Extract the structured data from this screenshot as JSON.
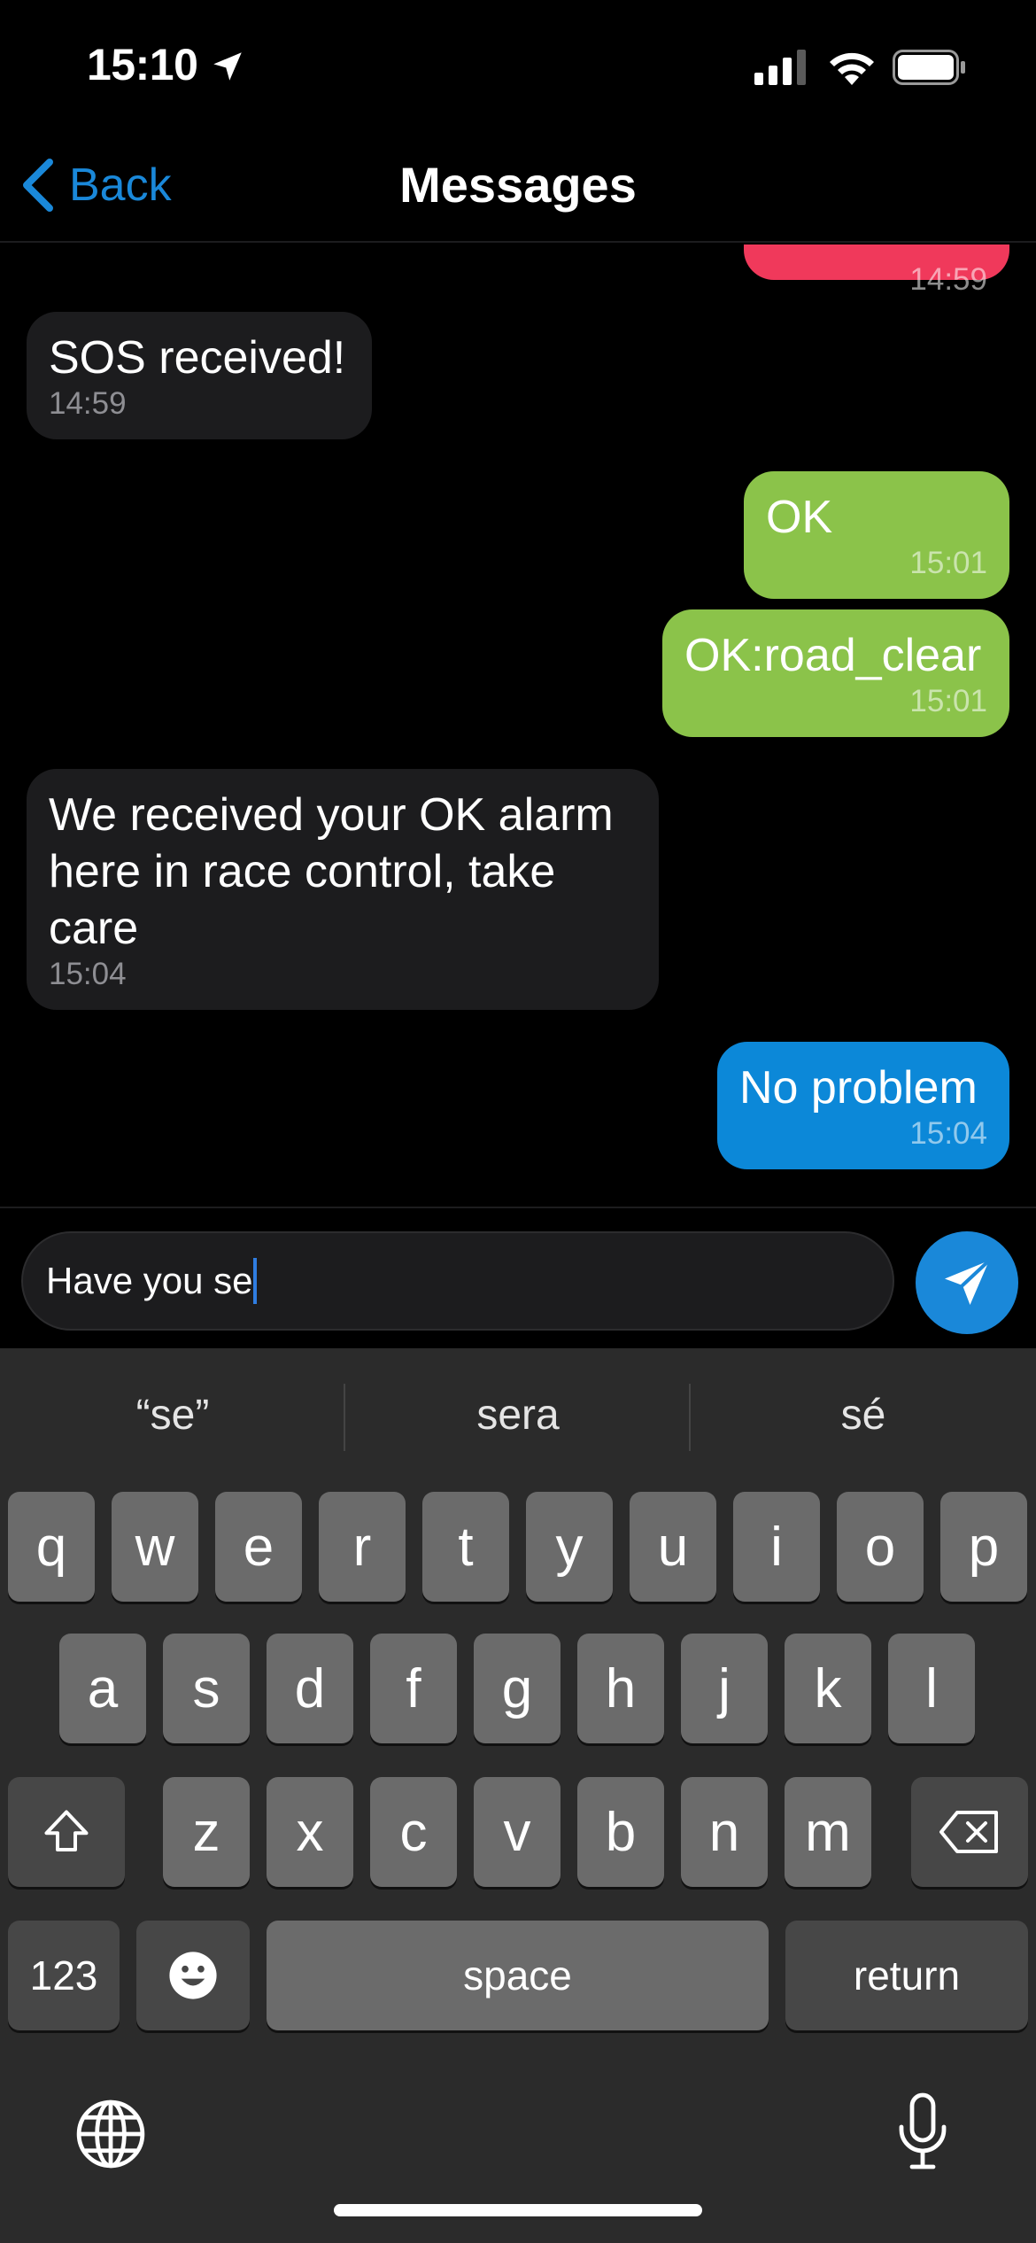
{
  "status_bar": {
    "time": "15:10",
    "icons": [
      "location-arrow-icon",
      "cellular-signal-icon",
      "wifi-icon",
      "battery-icon"
    ]
  },
  "nav": {
    "back_label": "Back",
    "title": "Messages"
  },
  "messages": [
    {
      "direction": "out",
      "text": "",
      "time": "14:59",
      "color": "#f0395b"
    },
    {
      "direction": "in",
      "text": "SOS received!",
      "time": "14:59",
      "color": "#1c1c1e"
    },
    {
      "direction": "out",
      "text": "OK",
      "time": "15:01",
      "color": "#8bc34a"
    },
    {
      "direction": "out",
      "text": "OK:road_clear",
      "time": "15:01",
      "color": "#8bc34a"
    },
    {
      "direction": "in",
      "text": "We received your OK alarm here in race control, take care",
      "time": "15:04",
      "color": "#1c1c1e"
    },
    {
      "direction": "out",
      "text": "No problem",
      "time": "15:04",
      "color": "#0c88d8"
    }
  ],
  "composer": {
    "value": "Have you se",
    "send_icon": "paper-plane-icon"
  },
  "keyboard": {
    "suggestions": [
      "“se”",
      "sera",
      "sé"
    ],
    "row1": [
      "q",
      "w",
      "e",
      "r",
      "t",
      "y",
      "u",
      "i",
      "o",
      "p"
    ],
    "row2": [
      "a",
      "s",
      "d",
      "f",
      "g",
      "h",
      "j",
      "k",
      "l"
    ],
    "row3": [
      "z",
      "x",
      "c",
      "v",
      "b",
      "n",
      "m"
    ],
    "numbers_label": "123",
    "space_label": "space",
    "return_label": "return",
    "icons": [
      "shift-icon",
      "backspace-icon",
      "emoji-icon",
      "globe-icon",
      "microphone-icon"
    ]
  },
  "colors": {
    "accent": "#1a88d9",
    "background": "#000000",
    "keyboard_bg": "#2b2b2b"
  }
}
